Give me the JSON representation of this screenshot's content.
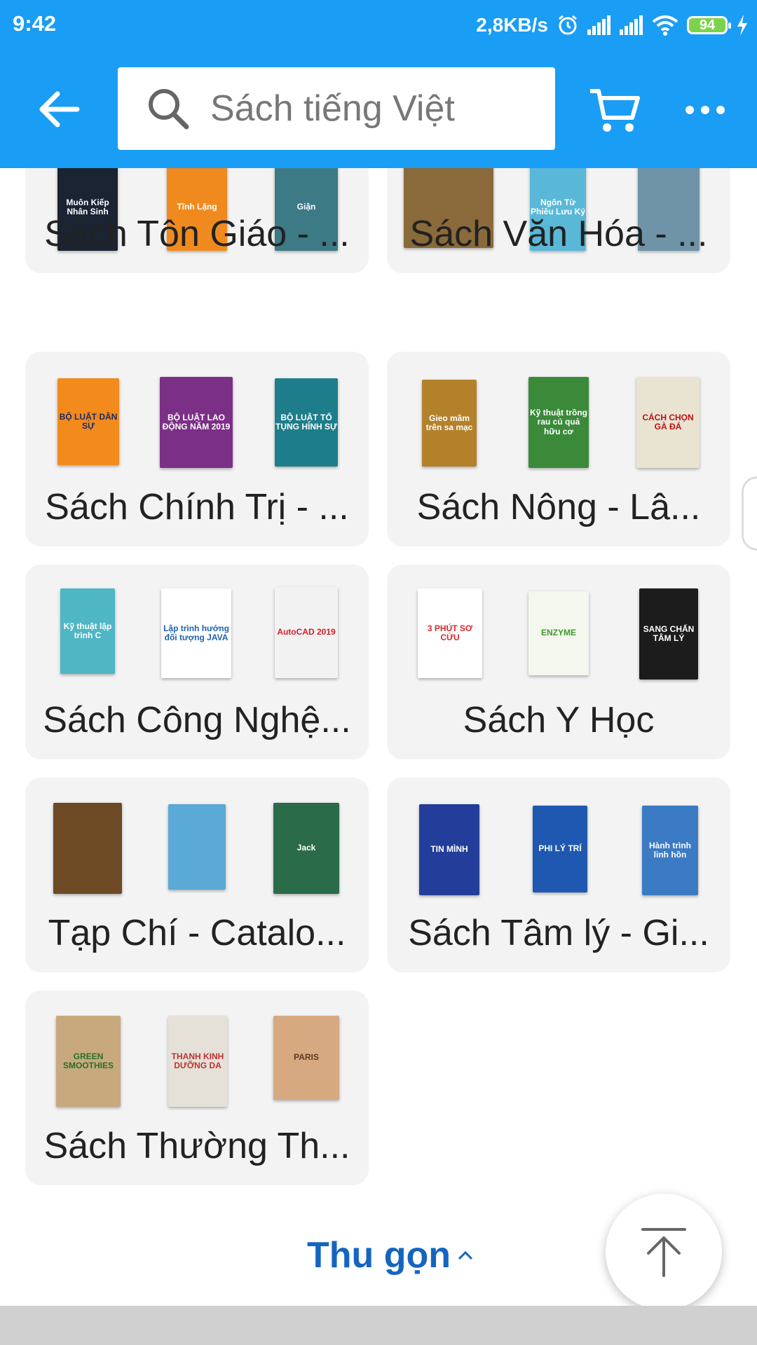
{
  "status_bar": {
    "time": "9:42",
    "speed": "2,8KB/s",
    "battery": "94"
  },
  "search": {
    "placeholder": "Sách tiếng Việt"
  },
  "categories": [
    {
      "label": "Sách Tôn Giáo - ...",
      "covers": [
        "Muôn Kiếp Nhân Sinh",
        "Tĩnh Lặng",
        "Giận"
      ]
    },
    {
      "label": "Sách Văn Hóa - ...",
      "covers": [
        "",
        "Ngôn Từ Phiêu Lưu Ký",
        ""
      ]
    },
    {
      "label": "Sách Chính Trị - ...",
      "covers": [
        "BỘ LUẬT DÂN SỰ",
        "BỘ LUẬT LAO ĐỘNG NĂM 2019",
        "BỘ LUẬT TỐ TỤNG HÌNH SỰ"
      ]
    },
    {
      "label": "Sách Nông - Lâ...",
      "covers": [
        "Gieo mầm trên sa mạc",
        "Kỹ thuật trồng rau củ quả hữu cơ",
        "CÁCH CHỌN GÀ ĐÁ"
      ]
    },
    {
      "label": "Sách Công Nghệ...",
      "covers": [
        "Kỹ thuật lập trình C",
        "Lập trình hướng đối tượng JAVA",
        "AutoCAD 2019"
      ]
    },
    {
      "label": "Sách Y Học",
      "covers": [
        "3 PHÚT SƠ CỨU",
        "ENZYME",
        "SANG CHẤN TÂM LÝ"
      ]
    },
    {
      "label": "Tạp Chí - Catalo...",
      "covers": [
        "",
        "",
        "Jack"
      ]
    },
    {
      "label": "Sách Tâm lý - Gi...",
      "covers": [
        "TIN MÌNH",
        "PHI LÝ TRÍ",
        "Hành trình linh hồn"
      ]
    },
    {
      "label": "Sách Thường Th...",
      "covers": [
        "GREEN SMOOTHIES",
        "THANH KINH DƯỠNG DA",
        "PARIS"
      ]
    }
  ],
  "collapse": {
    "label": "Thu gọn"
  },
  "colors": {
    "primary": "#1a9df4",
    "card_bg": "#f3f3f3",
    "link": "#1565c0"
  }
}
